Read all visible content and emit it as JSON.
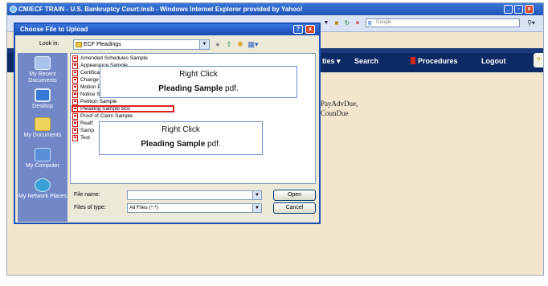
{
  "browser": {
    "title": "CM/ECF TRAIN - U.S. Bankruptcy Court:insb - Windows Internet Explorer provided by Yahoo!",
    "min": "_",
    "max": "▫",
    "close": "x",
    "search_placeholder": "Google",
    "search_icon": "search-icon"
  },
  "app_nav": {
    "items": [
      "ties ▾",
      "Search",
      "Procedures",
      "Logout"
    ]
  },
  "page_text": [
    "PayAdvDue,",
    "CounDue"
  ],
  "dialog": {
    "title": "Choose File to Upload",
    "help": "?",
    "close": "x",
    "look_in_label": "Look in:",
    "look_in_value": "ECF Pleadings",
    "places": [
      "My Recent Documents",
      "Desktop",
      "My Documents",
      "My Computer",
      "My Network Places"
    ],
    "files": [
      "Amended Schedules Sample",
      "Appearance Sample",
      "Certificat",
      "Change o",
      "Motion PC",
      "Notice Sa",
      "Petition Sample",
      "Pleading Sample Box",
      "Proof of Claim Sample",
      "Reaff",
      "Samp",
      "Test"
    ],
    "file_name_label": "File name:",
    "file_name_value": "",
    "file_type_label": "Files of type:",
    "file_type_value": "All Files (*.*)",
    "open_label": "Open",
    "cancel_label": "Cancel"
  },
  "callouts": [
    {
      "line1": "Right Click",
      "line2": "Pleading Sample",
      "suffix": " pdf."
    },
    {
      "line1": "Right Click",
      "line2": "Pleading Sample",
      "suffix": " pdf."
    }
  ]
}
